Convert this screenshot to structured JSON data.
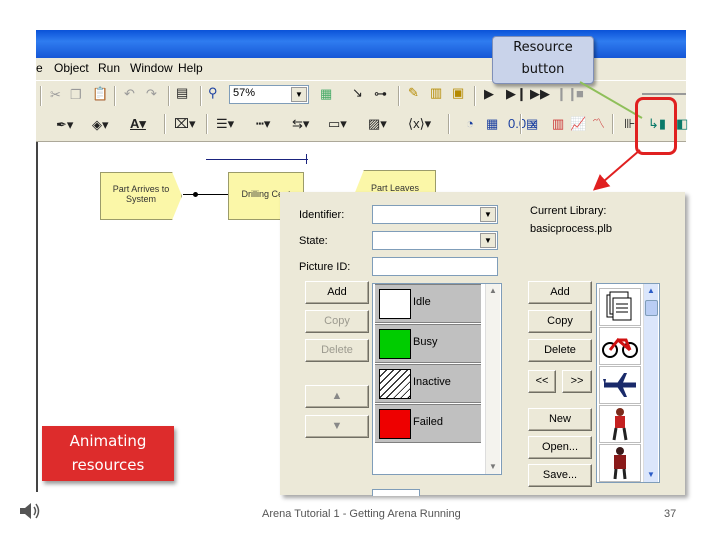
{
  "menu": [
    "e",
    "Object",
    "Run",
    "Window",
    "Help"
  ],
  "toolbar": {
    "zoom_value": "57%"
  },
  "callout": {
    "line1": "Resource",
    "line2": "button"
  },
  "modules": {
    "part_arrives": {
      "line1": "Part Arrives to",
      "line2": "System"
    },
    "drilling": "Drilling Cent",
    "part_leaves": "Part Leaves"
  },
  "dialog": {
    "identifier_label": "Identifier:",
    "state_label": "State:",
    "picture_id_label": "Picture ID:",
    "current_library_label": "Current Library:",
    "library_file": "basicprocess.plb",
    "left_buttons": {
      "add": "Add",
      "copy": "Copy",
      "delete": "Delete"
    },
    "states": [
      {
        "name": "Idle",
        "color": "#ffffff"
      },
      {
        "name": "Busy",
        "color": "#00cc00"
      },
      {
        "name": "Inactive",
        "color": "hatched"
      },
      {
        "name": "Failed",
        "color": "#ee0000"
      }
    ],
    "right_buttons": {
      "add": "Add",
      "copy": "Copy",
      "delete": "Delete",
      "prev": "<<",
      "next": ">>",
      "new": "New",
      "open": "Open...",
      "save": "Save..."
    },
    "library_icons": [
      "documents-icon",
      "bicycle-icon",
      "airplane-icon",
      "person-icon",
      "person-dark-icon"
    ]
  },
  "side_label": {
    "line1": "Animating",
    "line2": "resources"
  },
  "footer": "Arena Tutorial 1 - Getting Arena Running",
  "page_number": "37"
}
